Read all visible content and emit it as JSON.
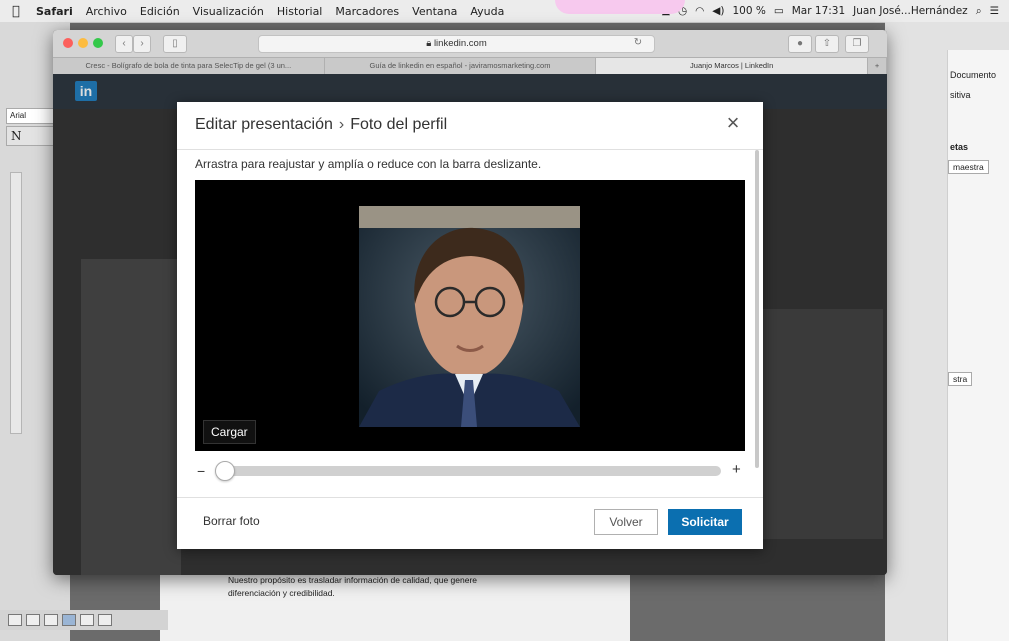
{
  "menubar": {
    "app": "Safari",
    "items": [
      "Archivo",
      "Edición",
      "Visualización",
      "Historial",
      "Marcadores",
      "Ventana",
      "Ayuda"
    ],
    "battery": "100 %",
    "clock": "Mar 17:31",
    "user": "Juan José...Hernández"
  },
  "browser": {
    "url": "linkedin.com",
    "tabs": [
      "Cresc - Bolígrafo de bola de tinta para SelecTip de gel (3 un...",
      "Guía de linkedin en español - javiramosmarketing.com",
      "Juanjo Marcos | LinkedIn"
    ],
    "logo": "in"
  },
  "modal": {
    "title": "Editar presentación",
    "separator": "›",
    "subtitle": "Foto del perfil",
    "close": "×",
    "description": "Arrastra para reajustar y amplía o reduce con la barra deslizante.",
    "upload_label": "Cargar",
    "slider_minus": "−",
    "slider_plus": "+",
    "zoom_level": 0,
    "delete_label": "Borrar foto",
    "back_label": "Volver",
    "apply_label": "Solicitar"
  },
  "background": {
    "font_field": "Arial",
    "style_box": "N",
    "right_labels": [
      "Documento",
      "sitiva",
      "etas",
      "maestra",
      "stra"
    ],
    "doc_lines": [
      "Nuestro propósito es trasladar información de calidad, que genere",
      "diferenciación y credibilidad."
    ]
  },
  "colors": {
    "accent": "#0b6fb0",
    "linkedin_nav": "#283038"
  }
}
